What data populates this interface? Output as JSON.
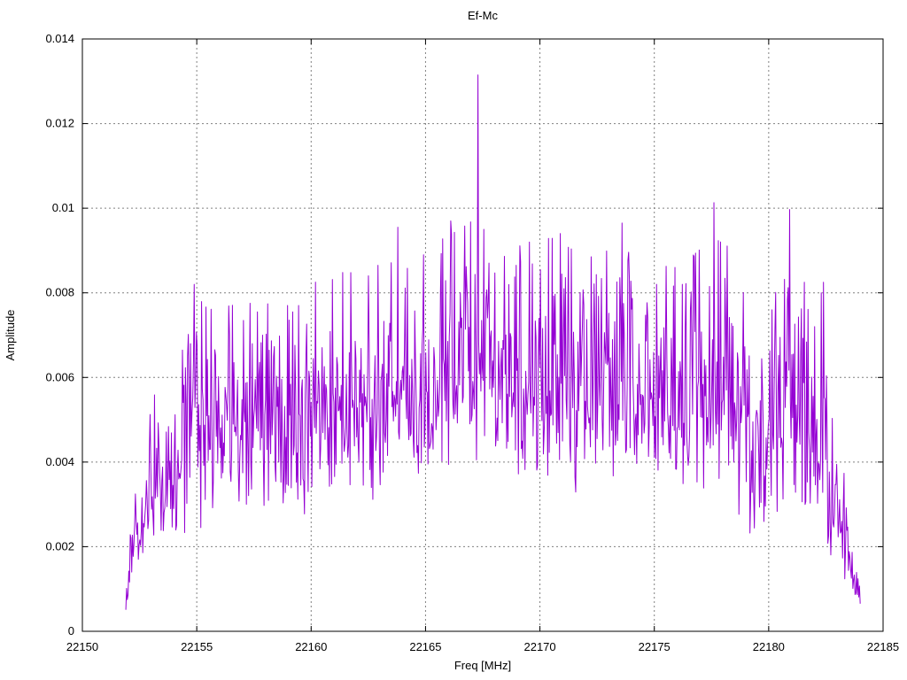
{
  "window": {
    "background": "#ffffff"
  },
  "chart_data": {
    "type": "line",
    "title": "Ef-Mc",
    "xlabel": "Freq [MHz]",
    "ylabel": "Amplitude",
    "xlim": [
      22150,
      22185
    ],
    "ylim": [
      0,
      0.014
    ],
    "grid": true,
    "legend_position": "none",
    "grid_color": "#808080",
    "axis_color": "#000000",
    "background_color": "#ffffff",
    "xticks": {
      "values": [
        22150,
        22155,
        22160,
        22165,
        22170,
        22175,
        22180,
        22185
      ],
      "labels": [
        "22150",
        "22155",
        "22160",
        "22165",
        "22170",
        "22175",
        "22180",
        "22185"
      ]
    },
    "yticks": {
      "values": [
        0,
        0.002,
        0.004,
        0.006,
        0.008,
        0.01,
        0.012,
        0.014
      ],
      "labels": [
        "0",
        "0.002",
        "0.004",
        "0.006",
        "0.008",
        "0.01",
        "0.012",
        "0.014"
      ]
    },
    "series": [
      {
        "name": "Ef-Mc",
        "color": "#9400d3",
        "style": "dense noisy amplitude spectrum line",
        "x_start": 22151.9,
        "x_end": 22184.0,
        "points": 1000,
        "envelope": [
          [
            22151.9,
            0.0004,
            0.0011
          ],
          [
            22152.2,
            0.0008,
            0.003
          ],
          [
            22152.7,
            0.0013,
            0.0045
          ],
          [
            22153.2,
            0.0018,
            0.0057
          ],
          [
            22153.7,
            0.0016,
            0.0048
          ],
          [
            22154.2,
            0.002,
            0.0062
          ],
          [
            22154.9,
            0.0022,
            0.008
          ],
          [
            22155.5,
            0.0024,
            0.0076
          ],
          [
            22156.5,
            0.0024,
            0.0077
          ],
          [
            22157.5,
            0.0028,
            0.0078
          ],
          [
            22158.5,
            0.0026,
            0.0077
          ],
          [
            22159.5,
            0.0024,
            0.0077
          ],
          [
            22160.5,
            0.0026,
            0.0085
          ],
          [
            22161.5,
            0.003,
            0.0085
          ],
          [
            22162.5,
            0.0028,
            0.0084
          ],
          [
            22163.5,
            0.003,
            0.0092
          ],
          [
            22164.5,
            0.0028,
            0.0088
          ],
          [
            22165.5,
            0.0032,
            0.0092
          ],
          [
            22166.5,
            0.0034,
            0.0095
          ],
          [
            22167.3,
            0.0036,
            0.0098
          ],
          [
            22168.5,
            0.0032,
            0.0091
          ],
          [
            22169.5,
            0.0034,
            0.0092
          ],
          [
            22170.5,
            0.003,
            0.0093
          ],
          [
            22171.5,
            0.0032,
            0.009
          ],
          [
            22172.5,
            0.0034,
            0.0088
          ],
          [
            22173.6,
            0.0034,
            0.0093
          ],
          [
            22174.5,
            0.0036,
            0.0082
          ],
          [
            22175.5,
            0.0032,
            0.0087
          ],
          [
            22176.5,
            0.0028,
            0.0088
          ],
          [
            22177.6,
            0.0025,
            0.0093
          ],
          [
            22178.5,
            0.0026,
            0.009
          ],
          [
            22179.6,
            0.0015,
            0.0062
          ],
          [
            22180.3,
            0.0024,
            0.008
          ],
          [
            22180.9,
            0.0022,
            0.0092
          ],
          [
            22181.7,
            0.0024,
            0.0083
          ],
          [
            22182.3,
            0.002,
            0.008
          ],
          [
            22182.8,
            0.0016,
            0.0062
          ],
          [
            22183.2,
            0.0012,
            0.0042
          ],
          [
            22183.6,
            0.0008,
            0.0022
          ],
          [
            22184.0,
            0.0005,
            0.0012
          ]
        ],
        "peaks": [
          [
            22167.3,
            0.01315
          ],
          [
            22167.55,
            0.0095
          ],
          [
            22177.6,
            0.01013
          ],
          [
            22180.9,
            0.00997
          ],
          [
            22163.8,
            0.00955
          ],
          [
            22166.1,
            0.0097
          ],
          [
            22173.6,
            0.00965
          ],
          [
            22170.9,
            0.0094
          ],
          [
            22169.55,
            0.0092
          ],
          [
            22164.9,
            0.0089
          ],
          [
            22154.9,
            0.0082
          ],
          [
            22159.45,
            0.0077
          ],
          [
            22181.55,
            0.00825
          ],
          [
            22182.4,
            0.00825
          ],
          [
            22175.9,
            0.0086
          ]
        ]
      }
    ]
  }
}
